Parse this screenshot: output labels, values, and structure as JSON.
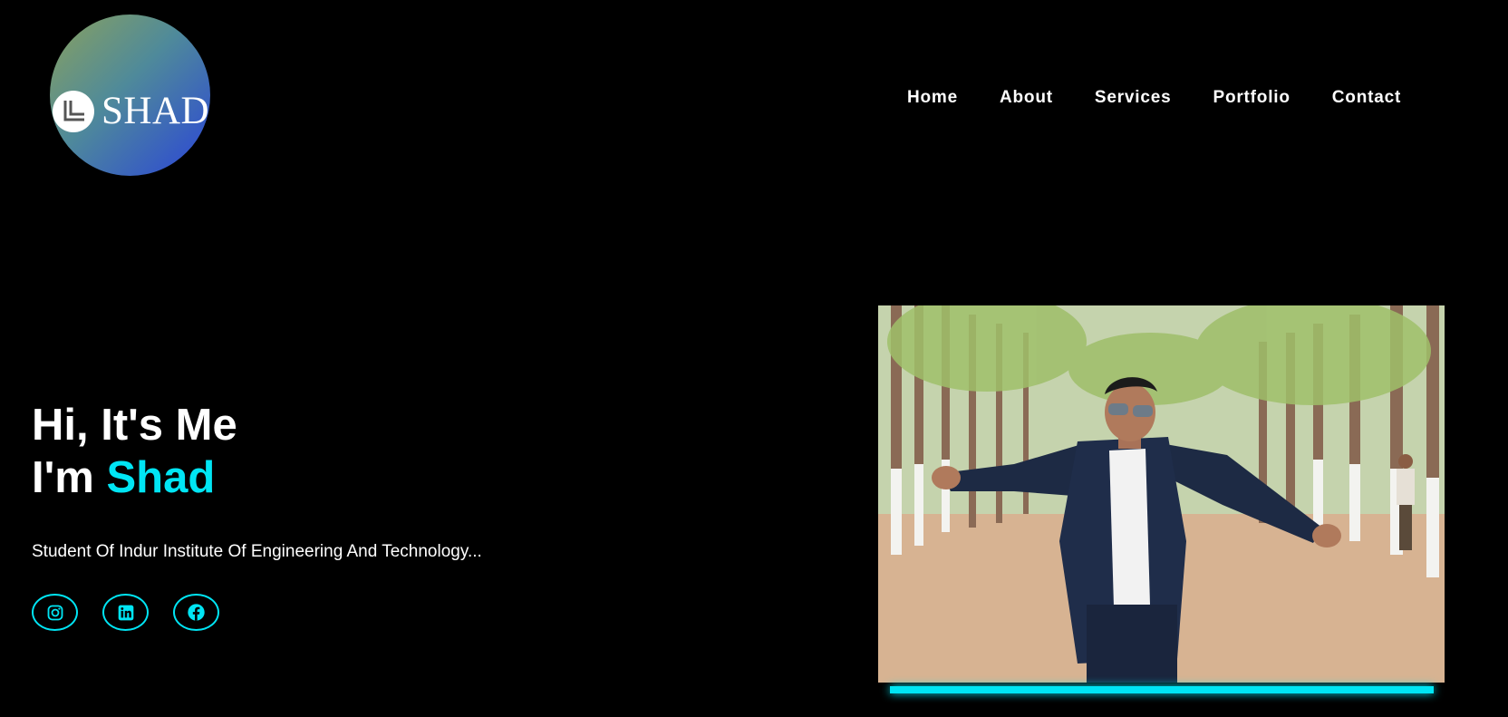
{
  "brand": {
    "logo_text": "SHAD"
  },
  "nav": {
    "items": [
      "Home",
      "About",
      "Services",
      "Portfolio",
      "Contact"
    ]
  },
  "hero": {
    "line1": "Hi, It's Me",
    "line2_prefix": "I'm ",
    "line2_name": "Shad",
    "subtitle": "Student Of Indur Institute Of Engineering And Technology..."
  },
  "socials": [
    {
      "icon": "instagram-icon"
    },
    {
      "icon": "linkedin-icon"
    },
    {
      "icon": "facebook-icon"
    }
  ],
  "colors": {
    "background": "#000000",
    "accent": "#00e5f4",
    "text": "#ffffff"
  }
}
